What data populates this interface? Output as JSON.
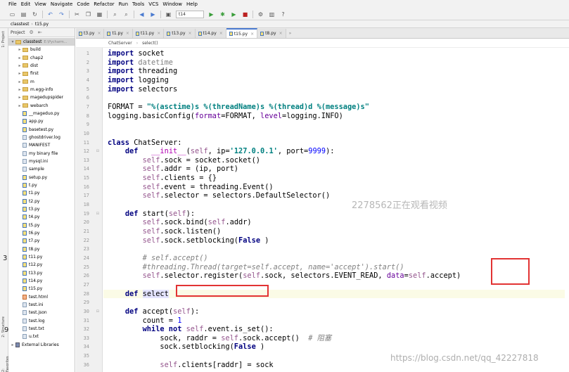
{
  "menu": [
    "File",
    "Edit",
    "View",
    "Navigate",
    "Code",
    "Refactor",
    "Run",
    "Tools",
    "VCS",
    "Window",
    "Help"
  ],
  "toolbar": {
    "run_config": "t14"
  },
  "nav": {
    "project": "classtest",
    "file": "t15.py"
  },
  "sidebar": {
    "project_tab": "1: Project",
    "structure_tab": "2: Structure",
    "favorites_tab": "2: Favorites",
    "header_label": "Project",
    "root_label": "classtest",
    "root_path": "E:\\Pycharm...",
    "items": [
      {
        "label": "build",
        "kind": "folder"
      },
      {
        "label": "chap2",
        "kind": "folder"
      },
      {
        "label": "dist",
        "kind": "folder"
      },
      {
        "label": "first",
        "kind": "folder"
      },
      {
        "label": "m",
        "kind": "folder"
      },
      {
        "label": "m.egg-info",
        "kind": "folder"
      },
      {
        "label": "magedupspider",
        "kind": "folder"
      },
      {
        "label": "webarch",
        "kind": "folder"
      },
      {
        "label": "__mageduo.py",
        "kind": "py"
      },
      {
        "label": "app.py",
        "kind": "py"
      },
      {
        "label": "basetest.py",
        "kind": "py"
      },
      {
        "label": "ghostdriver.log",
        "kind": "file"
      },
      {
        "label": "MANIFEST",
        "kind": "file"
      },
      {
        "label": "my binary file",
        "kind": "file"
      },
      {
        "label": "mysql.ini",
        "kind": "file"
      },
      {
        "label": "sample",
        "kind": "file"
      },
      {
        "label": "setup.py",
        "kind": "py"
      },
      {
        "label": "t.py",
        "kind": "py"
      },
      {
        "label": "t1.py",
        "kind": "py"
      },
      {
        "label": "t2.py",
        "kind": "py"
      },
      {
        "label": "t3.py",
        "kind": "py"
      },
      {
        "label": "t4.py",
        "kind": "py"
      },
      {
        "label": "t5.py",
        "kind": "py"
      },
      {
        "label": "t6.py",
        "kind": "py"
      },
      {
        "label": "t7.py",
        "kind": "py"
      },
      {
        "label": "t8.py",
        "kind": "py"
      },
      {
        "label": "t11.py",
        "kind": "py"
      },
      {
        "label": "t12.py",
        "kind": "py"
      },
      {
        "label": "t13.py",
        "kind": "py"
      },
      {
        "label": "t14.py",
        "kind": "py"
      },
      {
        "label": "t15.py",
        "kind": "py"
      },
      {
        "label": "test.html",
        "kind": "html"
      },
      {
        "label": "test.ini",
        "kind": "file"
      },
      {
        "label": "test.json",
        "kind": "file"
      },
      {
        "label": "test.log",
        "kind": "file"
      },
      {
        "label": "test.txt",
        "kind": "file"
      },
      {
        "label": "u.txt",
        "kind": "file"
      }
    ],
    "external_libraries": "External Libraries"
  },
  "tabs": [
    {
      "label": "t3.py",
      "active": false
    },
    {
      "label": "t1.py",
      "active": false
    },
    {
      "label": "t11.py",
      "active": false
    },
    {
      "label": "t13.py",
      "active": false
    },
    {
      "label": "t14.py",
      "active": false
    },
    {
      "label": "t15.py",
      "active": true
    },
    {
      "label": "t8.py",
      "active": false
    }
  ],
  "editor_crumb": [
    "ChatServer",
    "select()"
  ],
  "code": {
    "start_line": 1,
    "current_line": 28,
    "lines": [
      [
        [
          "kw",
          "import"
        ],
        [
          "",
          "socket"
        ]
      ],
      [
        [
          "kw",
          "import"
        ],
        [
          "gr",
          "datetime"
        ]
      ],
      [
        [
          "kw",
          "import"
        ],
        [
          "",
          "threading"
        ]
      ],
      [
        [
          "kw",
          "import"
        ],
        [
          "",
          "logging"
        ]
      ],
      [
        [
          "kw",
          "import"
        ],
        [
          "",
          "selectors"
        ]
      ],
      [],
      [
        [
          "",
          "FORMAT = "
        ],
        [
          "st",
          "\"%(asctime)s %(threadName)s %(thread)d %(message)s\""
        ]
      ],
      [
        [
          "",
          "logging.basicConfig("
        ],
        [
          "kwa",
          "format"
        ],
        [
          "",
          "=FORMAT, "
        ],
        [
          "kwa",
          "level"
        ],
        [
          "",
          "=logging.INFO)"
        ]
      ],
      [],
      [],
      [
        [
          "kw",
          "class"
        ],
        [
          "",
          "ChatServer:"
        ]
      ],
      [
        [
          "",
          "    "
        ],
        [
          "kw",
          "def"
        ],
        [
          "",
          "  "
        ],
        [
          "dn",
          "__init__"
        ],
        [
          "",
          "("
        ],
        [
          "sf",
          "self"
        ],
        [
          "",
          ", ip="
        ],
        [
          "st",
          "'127.0.0.1'"
        ],
        [
          "",
          ", port="
        ],
        [
          "nu",
          "9999"
        ],
        [
          "",
          "):"
        ]
      ],
      [
        [
          "",
          "        "
        ],
        [
          "sf",
          "self"
        ],
        [
          "",
          ".sock = socket.socket()"
        ]
      ],
      [
        [
          "",
          "        "
        ],
        [
          "sf",
          "self"
        ],
        [
          "",
          ".addr = (ip, port)"
        ]
      ],
      [
        [
          "",
          "        "
        ],
        [
          "sf",
          "self"
        ],
        [
          "",
          ".clients = {}"
        ]
      ],
      [
        [
          "",
          "        "
        ],
        [
          "sf",
          "self"
        ],
        [
          "",
          ".event = threading.Event()"
        ]
      ],
      [
        [
          "",
          "        "
        ],
        [
          "sf",
          "self"
        ],
        [
          "",
          ".selector = selectors.DefaultSelector()"
        ]
      ],
      [],
      [
        [
          "",
          "    "
        ],
        [
          "kw",
          "def"
        ],
        [
          "",
          "start("
        ],
        [
          "sf",
          "self"
        ],
        [
          "",
          "):"
        ]
      ],
      [
        [
          "",
          "        "
        ],
        [
          "sf",
          "self"
        ],
        [
          "",
          ".sock.bind("
        ],
        [
          "sf",
          "self"
        ],
        [
          "",
          ".addr)"
        ]
      ],
      [
        [
          "",
          "        "
        ],
        [
          "sf",
          "self"
        ],
        [
          "",
          ".sock.listen()"
        ]
      ],
      [
        [
          "",
          "        "
        ],
        [
          "sf",
          "self"
        ],
        [
          "",
          ".sock.setblocking("
        ],
        [
          "kw",
          "False"
        ],
        [
          "",
          ")"
        ]
      ],
      [],
      [
        [
          "",
          "        "
        ],
        [
          "cm",
          "# self.accept()"
        ]
      ],
      [
        [
          "",
          "        "
        ],
        [
          "cm",
          "#threading.Thread(target=self.accept, name='accept').start()"
        ]
      ],
      [
        [
          "",
          "        "
        ],
        [
          "sf",
          "self"
        ],
        [
          "",
          ".selector.register("
        ],
        [
          "sf",
          "self"
        ],
        [
          "",
          ".sock, selectors.EVENT_READ, "
        ],
        [
          "kwa",
          "data"
        ],
        [
          "",
          "="
        ],
        [
          "sf",
          "self"
        ],
        [
          "",
          ".accept)"
        ]
      ],
      [],
      [
        [
          "",
          "    "
        ],
        [
          "kw",
          "def"
        ],
        [
          "sel",
          "select"
        ],
        [
          "",
          ""
        ]
      ],
      [],
      [
        [
          "",
          "    "
        ],
        [
          "kw",
          "def"
        ],
        [
          "",
          "accept("
        ],
        [
          "sf",
          "self"
        ],
        [
          "",
          "):"
        ]
      ],
      [
        [
          "",
          "        count = "
        ],
        [
          "nu",
          "1"
        ]
      ],
      [
        [
          "",
          "        "
        ],
        [
          "kw",
          "while not"
        ],
        [
          "",
          ""
        ],
        [
          "sf",
          "self"
        ],
        [
          "",
          ".event.is_set():"
        ]
      ],
      [
        [
          "",
          "            sock, raddr = "
        ],
        [
          "sf",
          "self"
        ],
        [
          "",
          ".sock.accept()  "
        ],
        [
          "cm",
          "# 阻塞"
        ]
      ],
      [
        [
          "",
          "            sock.setblocking("
        ],
        [
          "kw",
          "False"
        ],
        [
          "",
          ")"
        ]
      ],
      [],
      [
        [
          "",
          "            "
        ],
        [
          "sf",
          "self"
        ],
        [
          "",
          ".clients[raddr] = sock"
        ]
      ]
    ]
  },
  "overlays": {
    "watermark": "2278562正在观看视频",
    "csdn": "https://blog.csdn.net/qq_42227818",
    "left_edge_a": "3",
    "left_edge_b": "9"
  }
}
